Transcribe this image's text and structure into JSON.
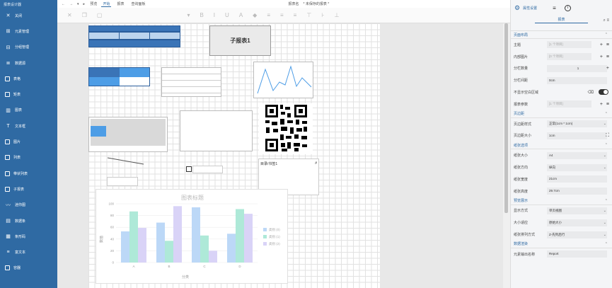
{
  "sidebar": {
    "app_title": "报表设计器",
    "items": [
      {
        "label": "关闭",
        "icon": "close-icon"
      },
      {
        "label": "元素管理",
        "icon": "grid-icon"
      },
      {
        "label": "分组管理",
        "icon": "tree-icon"
      },
      {
        "label": "数据源",
        "icon": "database-icon"
      },
      {
        "label": "表格",
        "icon": "table-icon"
      },
      {
        "label": "矩表",
        "icon": "matrix-icon"
      },
      {
        "label": "图表",
        "icon": "chart-icon"
      },
      {
        "label": "文本框",
        "icon": "textbox-icon"
      },
      {
        "label": "图片",
        "icon": "image-icon"
      },
      {
        "label": "列表",
        "icon": "list-icon"
      },
      {
        "label": "带状列表",
        "icon": "banded-list-icon"
      },
      {
        "label": "子报表",
        "icon": "subreport-icon"
      },
      {
        "label": "迷你图",
        "icon": "sparkline-icon"
      },
      {
        "label": "数据条",
        "icon": "databar-icon"
      },
      {
        "label": "条形码",
        "icon": "barcode-icon"
      },
      {
        "label": "富文本",
        "icon": "richtext-icon"
      },
      {
        "label": "容器",
        "icon": "container-icon"
      }
    ]
  },
  "topbar": {
    "preview": "预览",
    "tab_start": "开始",
    "tab_report": "报表",
    "tab_query": "查询面板",
    "report_name_label": "报表名",
    "unsaved": "* 未保存的报表 *"
  },
  "canvas": {
    "subreport_label": "子报表1",
    "toc_label": "目录/书签1",
    "toc_hash": "#",
    "chart_data": {
      "type": "bar",
      "title": "图表标题",
      "xlabel": "分类",
      "ylabel": "数值",
      "categories": [
        "A",
        "B",
        "C",
        "D"
      ],
      "ylim": [
        0,
        100
      ],
      "yticks": [
        "0",
        "20",
        "40",
        "60",
        "80",
        "100"
      ],
      "series": [
        {
          "name": "类别 (0)",
          "color": "#bcd8f7",
          "values": [
            53,
            68,
            94,
            49
          ]
        },
        {
          "name": "类别 (1)",
          "color": "#aee9d8",
          "values": [
            87,
            37,
            46,
            91
          ]
        },
        {
          "name": "类别 (2)",
          "color": "#d9d3f7",
          "values": [
            59,
            96,
            20,
            83
          ]
        }
      ]
    }
  },
  "panel": {
    "tab_page_settings": "属性设置",
    "subtab_report": "报表",
    "sections": {
      "page_layout": "页面布局",
      "page_header": "页边距",
      "paper": "纸张选项",
      "preview": "预览展示",
      "data_output": "数据渲染"
    },
    "rows": {
      "theme": "主题",
      "theme_val": "[1 个项目]",
      "inner_image": "内部图片",
      "inner_image_val": "[0 个项目]",
      "column_count": "分栏数量",
      "column_count_val": "1",
      "column_spacing": "分栏间距",
      "column_spacing_val": "0cm",
      "hide_blank": "不显示空白区域",
      "report_params": "报表参数",
      "report_params_val": "[1 个项目]",
      "margin_style": "页边距样式",
      "margin_style_val": "正常(1cm * 1cm)",
      "margin_size": "页边距大小",
      "margin_size_val": "1cm",
      "paper_size": "纸张大小",
      "paper_size_val": "A4",
      "paper_dir": "纸张方向",
      "paper_dir_val": "纵向",
      "paper_width": "纸张宽度",
      "paper_width_val": "21cm",
      "paper_height": "纸张高度",
      "paper_height_val": "29.7cm",
      "display_mode": "显示方式",
      "display_mode_val": "单页视图",
      "zoom_mode": "大小适应",
      "zoom_mode_val": "原始大小",
      "sheet_order": "纸张排列方式",
      "sheet_order_val": "Z-先列后行",
      "doc_name": "元素输出名称",
      "doc_name_val": "Report"
    }
  }
}
